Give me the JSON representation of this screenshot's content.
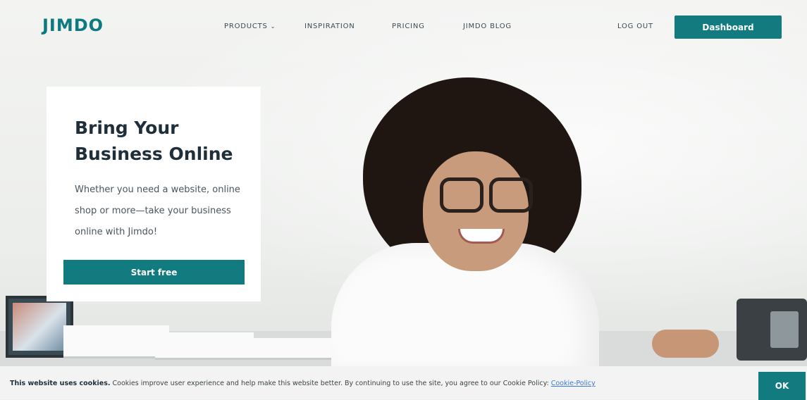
{
  "nav": {
    "logo": "JIMDO",
    "links": [
      "PRODUCTS",
      "INSPIRATION",
      "PRICING",
      "JIMDO BLOG"
    ],
    "logout": "LOG OUT",
    "dashboard": "Dashboard"
  },
  "hero": {
    "title": "Bring Your Business Online",
    "text": "Whether you need a website, online shop or more—take your business online with Jimdo!",
    "cta": "Start free"
  },
  "cookie": {
    "bold": "This website uses cookies.",
    "text": " Cookies improve user experience and help make this website better. By continuing to use the site, you agree to our Cookie Policy: ",
    "link": "Cookie-Policy",
    "ok": "OK"
  },
  "colors": {
    "accent": "#117b80",
    "logo": "#0d7a7f",
    "link": "#3a7bd5"
  }
}
